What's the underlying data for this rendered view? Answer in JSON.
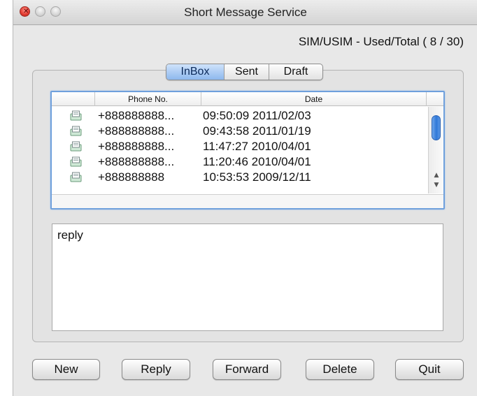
{
  "window": {
    "title": "Short Message Service"
  },
  "storage": {
    "text": "SIM/USIM - Used/Total ( 8 / 30)"
  },
  "tabs": [
    {
      "label": "InBox",
      "active": true
    },
    {
      "label": "Sent",
      "active": false
    },
    {
      "label": "Draft",
      "active": false
    }
  ],
  "table": {
    "columns": [
      "",
      "Phone No.",
      "Date"
    ],
    "rows": [
      {
        "icon": "message-icon",
        "phone": "+888888888...",
        "date": "09:50:09 2011/02/03"
      },
      {
        "icon": "message-icon",
        "phone": "+888888888...",
        "date": "09:43:58 2011/01/19"
      },
      {
        "icon": "message-icon",
        "phone": "+888888888...",
        "date": "11:47:27 2010/04/01"
      },
      {
        "icon": "message-icon",
        "phone": "+888888888...",
        "date": "11:20:46 2010/04/01"
      },
      {
        "icon": "message-icon",
        "phone": "+888888888",
        "date": "10:53:53 2009/12/11"
      }
    ]
  },
  "message": {
    "body": "reply"
  },
  "buttons": {
    "new": "New",
    "reply": "Reply",
    "forward": "Forward",
    "delete": "Delete",
    "quit": "Quit"
  },
  "colors": {
    "accent": "#6fa0dc",
    "close_button": "#e23a30",
    "selected_tab": "#8db8ee",
    "scroll_thumb": "#2f78d8"
  }
}
